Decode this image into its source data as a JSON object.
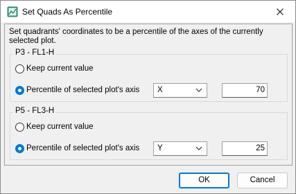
{
  "window": {
    "title": "Set Quads As Percentile",
    "app_icon": "chart-icon",
    "close_icon": "close-icon"
  },
  "description": "Set quadrants' coordinates to be a percentile of the axes of the currently selected plot.",
  "groups": [
    {
      "label": "P3 - FL1-H",
      "keep_label": "Keep current value",
      "percentile_label": "Percentile of selected plot's axis",
      "selected_option": "percentile",
      "axis": "X",
      "value": "70"
    },
    {
      "label": "P5 - FL3-H",
      "keep_label": "Keep current value",
      "percentile_label": "Percentile of selected plot's axis",
      "selected_option": "percentile",
      "axis": "Y",
      "value": "25"
    }
  ],
  "buttons": {
    "ok": "OK",
    "cancel": "Cancel"
  },
  "colors": {
    "accent": "#0078d4"
  }
}
